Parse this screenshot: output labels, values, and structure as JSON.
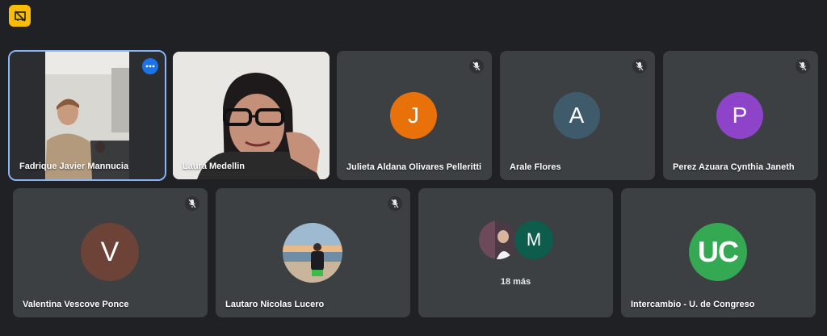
{
  "toolbar": {
    "present_icon": "present-off-icon"
  },
  "colors": {
    "background": "#202124",
    "tile": "#3c4043",
    "active_outline": "#8ab4f8",
    "accent": "#fbbc04"
  },
  "participants": [
    {
      "name": "Fadrique Javier Mannucia",
      "type": "video",
      "active": true
    },
    {
      "name": "Laura Medellin",
      "type": "video"
    },
    {
      "name": "Julieta Aldana Olivares Pelleritti",
      "initial": "J",
      "avatar_color": "#e8710a",
      "muted": true
    },
    {
      "name": "Arale Flores",
      "initial": "A",
      "avatar_color": "#3f5a6b",
      "muted": true
    },
    {
      "name": "Perez Azuara Cynthia Janeth",
      "initial": "P",
      "avatar_color": "#8e44c8",
      "muted": true
    },
    {
      "name": "Valentina Vescove Ponce",
      "initial": "V",
      "avatar_color": "#6d4338",
      "muted": true
    },
    {
      "name": "Lautaro Nicolas Lucero",
      "type": "photo",
      "muted": true
    },
    {
      "name": "Intercambio - U. de Congreso",
      "initial": "UC",
      "avatar_color": "#34a853"
    }
  ],
  "more_tile": {
    "count_label": "18 más",
    "second_initial": "M",
    "second_color": "#0d5c4c"
  }
}
